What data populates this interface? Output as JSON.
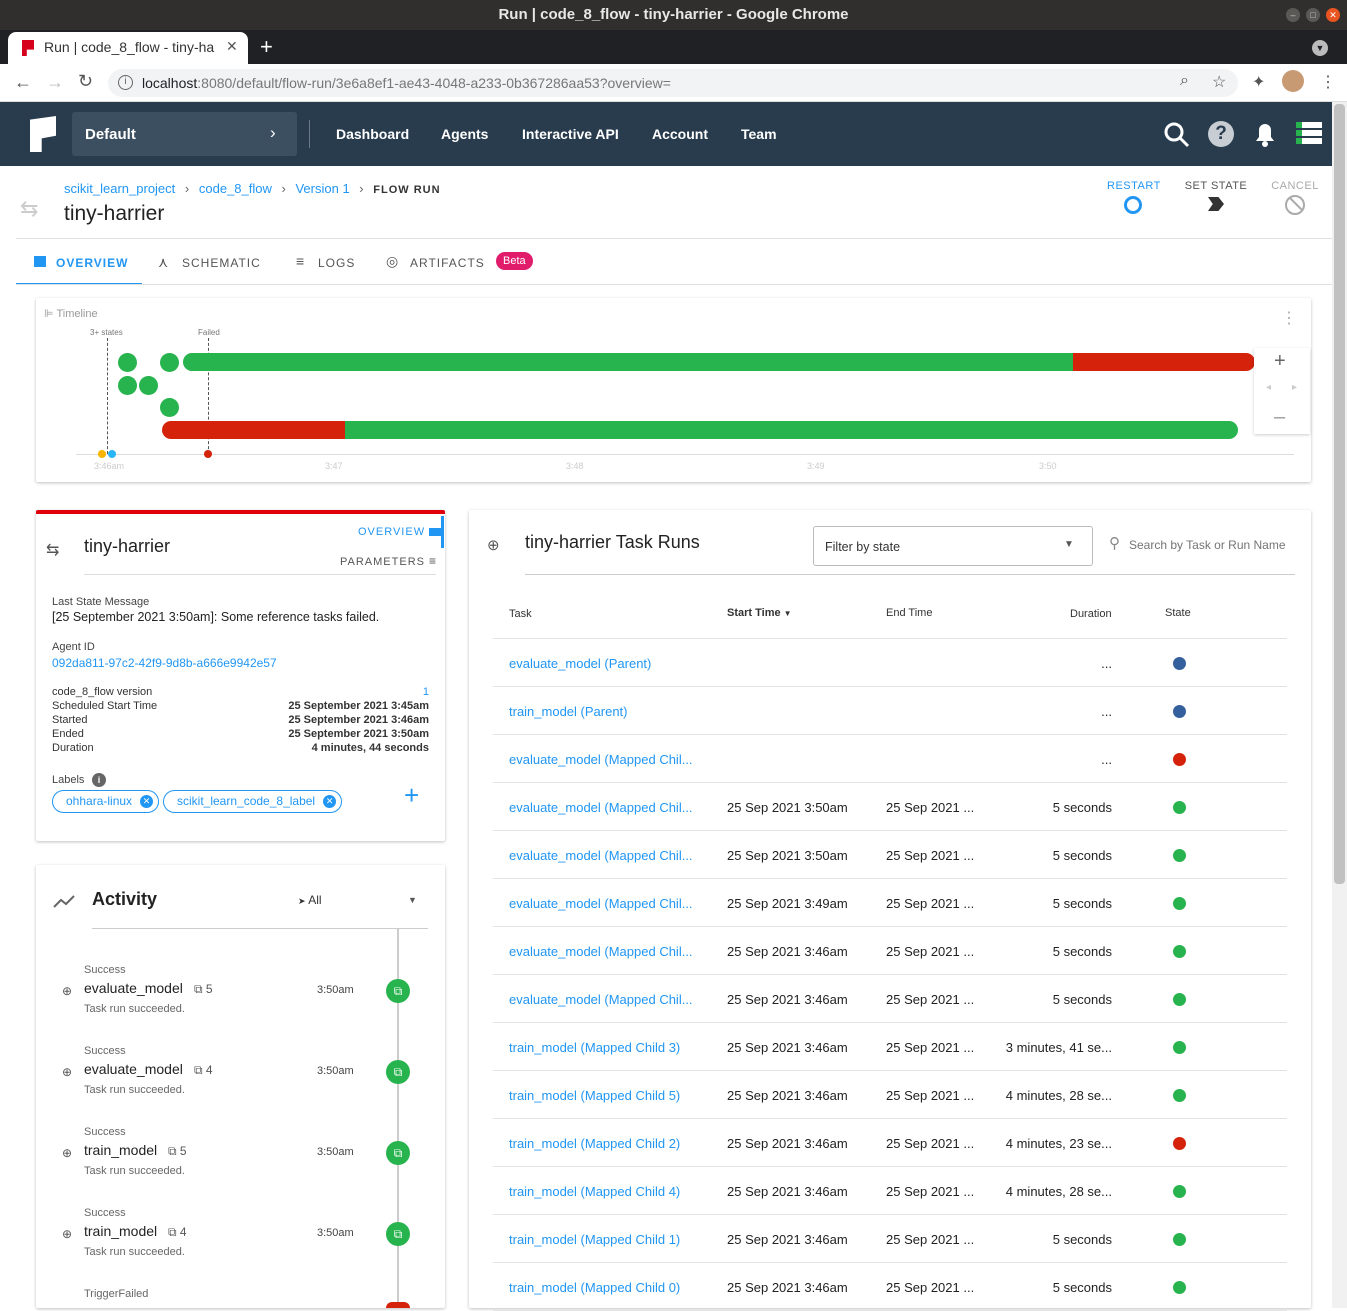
{
  "window": {
    "title": "Run | code_8_flow - tiny-harrier - Google Chrome",
    "tab_title": "Run | code_8_flow - tiny-ha",
    "url_host": "localhost",
    "url_rest": ":8080/default/flow-run/3e6a8ef1-ae43-4048-a233-0b367286aa53?overview="
  },
  "nav": {
    "project": "Default",
    "links": [
      "Dashboard",
      "Agents",
      "Interactive API",
      "Account",
      "Team"
    ]
  },
  "breadcrumb": {
    "items": [
      "scikit_learn_project",
      "code_8_flow",
      "Version 1"
    ],
    "current": "FLOW RUN",
    "title": "tiny-harrier"
  },
  "actions": {
    "restart": "RESTART",
    "set_state": "SET STATE",
    "cancel": "CANCEL"
  },
  "tabs": {
    "overview": "OVERVIEW",
    "schematic": "SCHEMATIC",
    "logs": "LOGS",
    "artifacts": "ARTIFACTS",
    "beta": "Beta"
  },
  "timeline": {
    "title": "Timeline",
    "marker1": "3+ states",
    "marker2": "Failed",
    "ticks": [
      "3:46am",
      "3:47",
      "3:48",
      "3:49",
      "3:50"
    ]
  },
  "details": {
    "name": "tiny-harrier",
    "overview_btn": "OVERVIEW",
    "parameters_btn": "PARAMETERS",
    "msg_label": "Last State Message",
    "msg": "[25 September 2021 3:50am]: Some reference tasks failed.",
    "agent_label": "Agent ID",
    "agent_id": "092da811-97c2-42f9-9d8b-a666e9942e57",
    "fields": [
      {
        "k": "code_8_flow version",
        "v": "1"
      },
      {
        "k": "Scheduled Start Time",
        "v": "25 September 2021 3:45am"
      },
      {
        "k": "Started",
        "v": "25 September 2021 3:46am"
      },
      {
        "k": "Ended",
        "v": "25 September 2021 3:50am"
      },
      {
        "k": "Duration",
        "v": "4 minutes, 44 seconds"
      }
    ],
    "labels_title": "Labels",
    "labels": [
      "ohhara-linux",
      "scikit_learn_code_8_label"
    ]
  },
  "activity": {
    "title": "Activity",
    "filter": "All",
    "items": [
      {
        "state": "Success",
        "name": "evaluate_model",
        "count": "5",
        "msg": "Task run succeeded.",
        "time": "3:50am"
      },
      {
        "state": "Success",
        "name": "evaluate_model",
        "count": "4",
        "msg": "Task run succeeded.",
        "time": "3:50am"
      },
      {
        "state": "Success",
        "name": "train_model",
        "count": "5",
        "msg": "Task run succeeded.",
        "time": "3:50am"
      },
      {
        "state": "Success",
        "name": "train_model",
        "count": "4",
        "msg": "Task run succeeded.",
        "time": "3:50am"
      },
      {
        "state": "TriggerFailed",
        "name": "",
        "count": "",
        "msg": "",
        "time": ""
      }
    ]
  },
  "taskruns": {
    "title": "tiny-harrier Task Runs",
    "filter_placeholder": "Filter by state",
    "search_placeholder": "Search by Task or Run Name",
    "headers": [
      "Task",
      "Start Time",
      "End Time",
      "Duration",
      "State"
    ],
    "rows": [
      {
        "task": "evaluate_model (Parent)",
        "start": "",
        "end": "",
        "duration": "...",
        "state": "b"
      },
      {
        "task": "train_model (Parent)",
        "start": "",
        "end": "",
        "duration": "...",
        "state": "b"
      },
      {
        "task": "evaluate_model (Mapped Chil...",
        "start": "",
        "end": "",
        "duration": "...",
        "state": "r"
      },
      {
        "task": "evaluate_model (Mapped Chil...",
        "start": "25 Sep 2021 3:50am",
        "end": "25 Sep 2021 ...",
        "duration": "5 seconds",
        "state": "g"
      },
      {
        "task": "evaluate_model (Mapped Chil...",
        "start": "25 Sep 2021 3:50am",
        "end": "25 Sep 2021 ...",
        "duration": "5 seconds",
        "state": "g"
      },
      {
        "task": "evaluate_model (Mapped Chil...",
        "start": "25 Sep 2021 3:49am",
        "end": "25 Sep 2021 ...",
        "duration": "5 seconds",
        "state": "g"
      },
      {
        "task": "evaluate_model (Mapped Chil...",
        "start": "25 Sep 2021 3:46am",
        "end": "25 Sep 2021 ...",
        "duration": "5 seconds",
        "state": "g"
      },
      {
        "task": "evaluate_model (Mapped Chil...",
        "start": "25 Sep 2021 3:46am",
        "end": "25 Sep 2021 ...",
        "duration": "5 seconds",
        "state": "g"
      },
      {
        "task": "train_model (Mapped Child 3)",
        "start": "25 Sep 2021 3:46am",
        "end": "25 Sep 2021 ...",
        "duration": "3 minutes, 41 se...",
        "state": "g"
      },
      {
        "task": "train_model (Mapped Child 5)",
        "start": "25 Sep 2021 3:46am",
        "end": "25 Sep 2021 ...",
        "duration": "4 minutes, 28 se...",
        "state": "g"
      },
      {
        "task": "train_model (Mapped Child 2)",
        "start": "25 Sep 2021 3:46am",
        "end": "25 Sep 2021 ...",
        "duration": "4 minutes, 23 se...",
        "state": "r"
      },
      {
        "task": "train_model (Mapped Child 4)",
        "start": "25 Sep 2021 3:46am",
        "end": "25 Sep 2021 ...",
        "duration": "4 minutes, 28 se...",
        "state": "g"
      },
      {
        "task": "train_model (Mapped Child 1)",
        "start": "25 Sep 2021 3:46am",
        "end": "25 Sep 2021 ...",
        "duration": "5 seconds",
        "state": "g"
      },
      {
        "task": "train_model (Mapped Child 0)",
        "start": "25 Sep 2021 3:46am",
        "end": "25 Sep 2021 ...",
        "duration": "5 seconds",
        "state": "g"
      }
    ]
  },
  "colors": {
    "success": "#27b34d",
    "failed": "#d4220b",
    "running": "#35609e",
    "accent": "#2196f3",
    "appbar": "#283c4e"
  }
}
